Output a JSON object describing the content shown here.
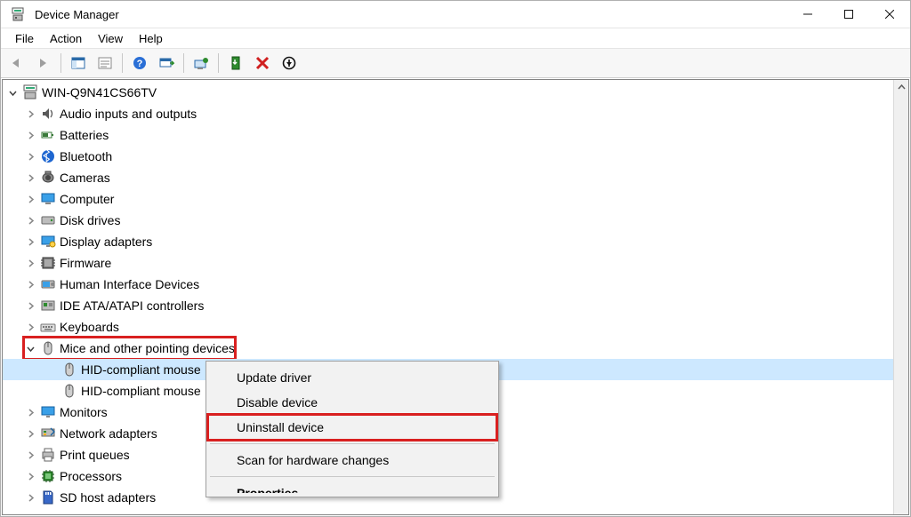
{
  "window": {
    "title": "Device Manager"
  },
  "menu": {
    "file": "File",
    "action": "Action",
    "view": "View",
    "help": "Help"
  },
  "tree": {
    "root": "WIN-Q9N41CS66TV",
    "items": [
      {
        "label": "Audio inputs and outputs",
        "icon": "audio"
      },
      {
        "label": "Batteries",
        "icon": "battery"
      },
      {
        "label": "Bluetooth",
        "icon": "bluetooth"
      },
      {
        "label": "Cameras",
        "icon": "camera"
      },
      {
        "label": "Computer",
        "icon": "computer"
      },
      {
        "label": "Disk drives",
        "icon": "disk"
      },
      {
        "label": "Display adapters",
        "icon": "display"
      },
      {
        "label": "Firmware",
        "icon": "firmware"
      },
      {
        "label": "Human Interface Devices",
        "icon": "hid"
      },
      {
        "label": "IDE ATA/ATAPI controllers",
        "icon": "ide"
      },
      {
        "label": "Keyboards",
        "icon": "keyboard"
      },
      {
        "label": "Mice and other pointing devices",
        "icon": "mouse",
        "expanded": true,
        "highlighted": true,
        "children": [
          {
            "label": "HID-compliant mouse",
            "icon": "mouse",
            "selected": true
          },
          {
            "label": "HID-compliant mouse",
            "icon": "mouse"
          }
        ]
      },
      {
        "label": "Monitors",
        "icon": "monitor"
      },
      {
        "label": "Network adapters",
        "icon": "network"
      },
      {
        "label": "Print queues",
        "icon": "printer"
      },
      {
        "label": "Processors",
        "icon": "cpu"
      },
      {
        "label": "SD host adapters",
        "icon": "sd"
      }
    ]
  },
  "context_menu": {
    "update": "Update driver",
    "disable": "Disable device",
    "uninstall": "Uninstall device",
    "scan": "Scan for hardware changes",
    "properties": "Properties",
    "highlighted": "uninstall"
  }
}
